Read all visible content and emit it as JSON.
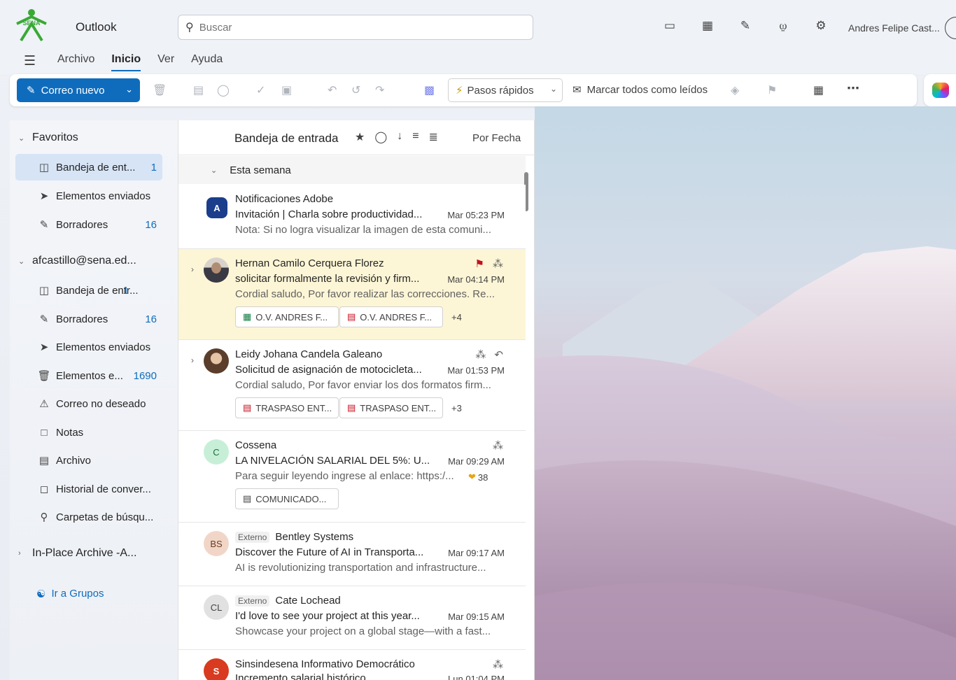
{
  "app": {
    "name": "Outlook",
    "logo_text": "SENA"
  },
  "search": {
    "placeholder": "Buscar"
  },
  "user": {
    "name": "Andres Felipe Cast..."
  },
  "menu": {
    "tabs": [
      "Archivo",
      "Inicio",
      "Ver",
      "Ayuda"
    ],
    "active": "Inicio"
  },
  "ribbon": {
    "new_mail": "Correo nuevo",
    "quick_steps": "Pasos rápidos",
    "mark_all_read": "Marcar todos como leídos"
  },
  "sidebar": {
    "favorites": {
      "label": "Favoritos",
      "items": [
        {
          "label": "Bandeja de ent...",
          "count": "1",
          "icon": "inbox-icon"
        },
        {
          "label": "Elementos enviados",
          "count": "",
          "icon": "send-icon"
        },
        {
          "label": "Borradores",
          "count": "16",
          "icon": "draft-icon"
        }
      ]
    },
    "account": {
      "label": "afcastillo@sena.ed...",
      "items": [
        {
          "label": "Bandeja de entr...",
          "count": "1",
          "icon": "inbox-icon"
        },
        {
          "label": "Borradores",
          "count": "16",
          "icon": "draft-icon"
        },
        {
          "label": "Elementos enviados",
          "count": "",
          "icon": "send-icon"
        },
        {
          "label": "Elementos e...",
          "count": "1690",
          "icon": "trash-icon"
        },
        {
          "label": "Correo no deseado",
          "count": "",
          "icon": "junk-icon"
        },
        {
          "label": "Notas",
          "count": "",
          "icon": "note-icon"
        },
        {
          "label": "Archivo",
          "count": "",
          "icon": "archive-icon"
        },
        {
          "label": "Historial de conver...",
          "count": "",
          "icon": "history-icon"
        },
        {
          "label": "Carpetas de búsqu...",
          "count": "",
          "icon": "search-folder-icon"
        }
      ]
    },
    "in_place": {
      "label": "In-Place Archive -A..."
    },
    "groups": {
      "label": "Ir a Grupos"
    }
  },
  "list": {
    "title": "Bandeja de entrada",
    "sort": "Por Fecha",
    "group": "Esta semana",
    "messages": [
      {
        "sender": "Notificaciones Adobe",
        "subject": "Invitación | Charla sobre productividad...",
        "time": "Mar 05:23 PM",
        "preview": "Nota: Si no logra visualizar la imagen de esta comuni...",
        "avatar": "A",
        "avatar_bg": "#1a3e8c",
        "avatar_fg": "#ffffff"
      },
      {
        "sender": "Hernan Camilo Cerquera Florez",
        "subject": "solicitar formalmente la revisión y firm...",
        "time": "Mar 04:14 PM",
        "preview": "Cordial saludo, Por favor realizar las correcciones. Re...",
        "avatar": "",
        "avatar_bg": "#7a6a5e",
        "avatar_fg": "#ffffff",
        "attachments": [
          "O.V. ANDRES F...",
          "O.V. ANDRES F..."
        ],
        "more": "+4"
      },
      {
        "sender": "Leidy Johana Candela Galeano",
        "subject": "Solicitud de asignación de motocicleta...",
        "time": "Mar 01:53 PM",
        "preview": "Cordial saludo, Por favor enviar los dos formatos firm...",
        "avatar": "",
        "avatar_bg": "#8b6f52",
        "avatar_fg": "#ffffff",
        "attachments": [
          "TRASPASO ENT...",
          "TRASPASO ENT..."
        ],
        "more": "+3"
      },
      {
        "sender": "Cossena",
        "subject": "LA NIVELACIÓN SALARIAL DEL 5%: U...",
        "time": "Mar 09:29 AM",
        "preview": "Para seguir leyendo ingrese al enlace: https:/...",
        "reactions": "38",
        "avatar": "C",
        "avatar_bg": "#c7efd8",
        "avatar_fg": "#1e6b3e",
        "attachments": [
          "COMUNICADO..."
        ]
      },
      {
        "sender": "Bentley Systems",
        "tag": "Externo",
        "subject": "Discover the Future of AI in Transporta...",
        "time": "Mar 09:17 AM",
        "preview": "AI is revolutionizing transportation and infrastructure...",
        "avatar": "BS",
        "avatar_bg": "#f1d6c7",
        "avatar_fg": "#6b3a22"
      },
      {
        "sender": "Cate Lochead",
        "tag": "Externo",
        "subject": "I'd love to see your project at this year...",
        "time": "Mar 09:15 AM",
        "preview": "Showcase your project on a global stage—with a fast...",
        "avatar": "CL",
        "avatar_bg": "#e1e1e1",
        "avatar_fg": "#424242"
      },
      {
        "sender": "Sinsindesena Informativo Democrático",
        "subject": "Incremento salarial histórico",
        "time": "Lun 01:04 PM",
        "preview": "",
        "avatar": "S",
        "avatar_bg": "#d83b1f",
        "avatar_fg": "#ffffff"
      }
    ]
  },
  "colors": {
    "accent": "#0f6cbd",
    "flag": "#c50f1f",
    "flagged_row": "#fdf6d6"
  }
}
